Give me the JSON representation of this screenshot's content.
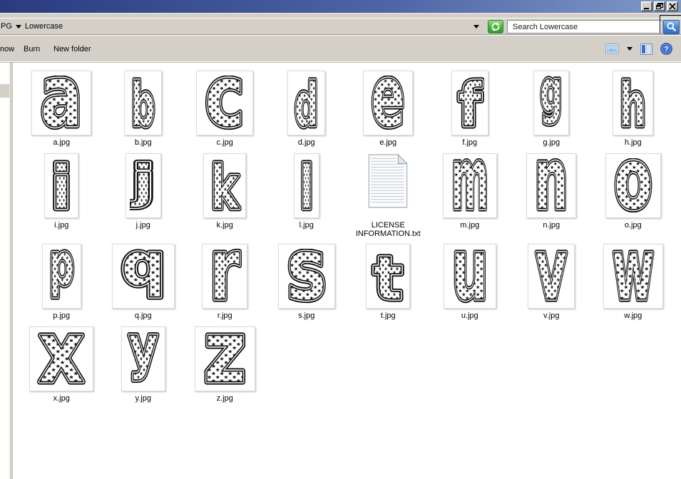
{
  "window": {
    "title": "",
    "controls": {
      "minimize": "minimize",
      "restore": "restore",
      "close": "close"
    }
  },
  "address_bar": {
    "breadcrumb_prefix": "PG",
    "breadcrumb_current": "Lowercase",
    "search_placeholder": "Search Lowercase"
  },
  "toolbar": {
    "items": [
      "now",
      "Burn",
      "New folder"
    ],
    "right_icons": [
      "slideshow-icon",
      "dropdown-arrow",
      "preview-pane-icon",
      "help-icon"
    ]
  },
  "colors": {
    "titlebar_left": "#2a3b80",
    "titlebar_right": "#8099c9",
    "chrome_face": "#d4d0c8",
    "refresh_green": "#52b445",
    "search_blue": "#4a86d4",
    "star_ink": "#111111"
  },
  "files": [
    {
      "label": "a.jpg",
      "letter": "a",
      "width": 84
    },
    {
      "label": "b.jpg",
      "letter": "b",
      "width": 53
    },
    {
      "label": "c.jpg",
      "letter": "c",
      "width": 80
    },
    {
      "label": "d.jpg",
      "letter": "d",
      "width": 53
    },
    {
      "label": "e.jpg",
      "letter": "e",
      "width": 70
    },
    {
      "label": "f.jpg",
      "letter": "f",
      "width": 52
    },
    {
      "label": "g.jpg",
      "letter": "g",
      "width": 50
    },
    {
      "label": "h.jpg",
      "letter": "h",
      "width": 57
    },
    {
      "label": "i.jpg",
      "letter": "i",
      "width": 48
    },
    {
      "label": "j.jpg",
      "letter": "j",
      "width": 50
    },
    {
      "label": "k.jpg",
      "letter": "k",
      "width": 60
    },
    {
      "label": "l.jpg",
      "letter": "l",
      "width": 36
    },
    {
      "label": "LICENSE INFORMATION.txt",
      "type": "text-document",
      "label_lines": [
        "LICENSE",
        "INFORMATION.txt"
      ],
      "width": 65
    },
    {
      "label": "m.jpg",
      "letter": "m",
      "width": 76
    },
    {
      "label": "n.jpg",
      "letter": "n",
      "width": 70
    },
    {
      "label": "o.jpg",
      "letter": "o",
      "width": 78
    },
    {
      "label": "p.jpg",
      "letter": "p",
      "width": 55
    },
    {
      "label": "q.jpg",
      "letter": "q",
      "width": 88
    },
    {
      "label": "r.jpg",
      "letter": "r",
      "width": 64
    },
    {
      "label": "s.jpg",
      "letter": "s",
      "width": 80
    },
    {
      "label": "t.jpg",
      "letter": "t",
      "width": 62
    },
    {
      "label": "u.jpg",
      "letter": "u",
      "width": 74
    },
    {
      "label": "v.jpg",
      "letter": "v",
      "width": 66
    },
    {
      "label": "w.jpg",
      "letter": "w",
      "width": 84
    },
    {
      "label": "x.jpg",
      "letter": "x",
      "width": 90
    },
    {
      "label": "y.jpg",
      "letter": "y",
      "width": 62
    },
    {
      "label": "z.jpg",
      "letter": "z",
      "width": 85
    }
  ]
}
